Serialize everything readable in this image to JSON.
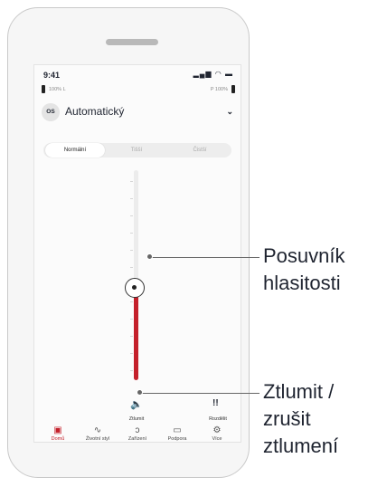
{
  "status": {
    "time": "9:41",
    "icons": "▂▄▆ ◠ ▬"
  },
  "batteries": {
    "left_text": "100% L",
    "right_text": "P 100%"
  },
  "program": {
    "icon_label": "OS",
    "name": "Automatický",
    "chevron": "⌄"
  },
  "tabs": [
    {
      "label": "Normální",
      "active": true
    },
    {
      "label": "Tišší",
      "active": false
    },
    {
      "label": "Čistší",
      "active": false
    }
  ],
  "volume": {
    "level": 0.44
  },
  "controls": {
    "mute": {
      "icon": "🔈",
      "label": "Ztlumit"
    },
    "split": {
      "icon": "ǃǃ",
      "label": "Rozdělit"
    }
  },
  "nav": [
    {
      "icon": "▣",
      "label": "Domů",
      "active": true
    },
    {
      "icon": "∿",
      "label": "Životní styl",
      "active": false
    },
    {
      "icon": "ↄ",
      "label": "Zařízení",
      "active": false
    },
    {
      "icon": "▭",
      "label": "Podpora",
      "active": false
    },
    {
      "icon": "⚙",
      "label": "Více",
      "active": false
    }
  ],
  "callouts": {
    "volume_slider": "Posuvník\nhlasitosti",
    "mute": "Ztlumit /\nzrušit\nztlumení"
  }
}
